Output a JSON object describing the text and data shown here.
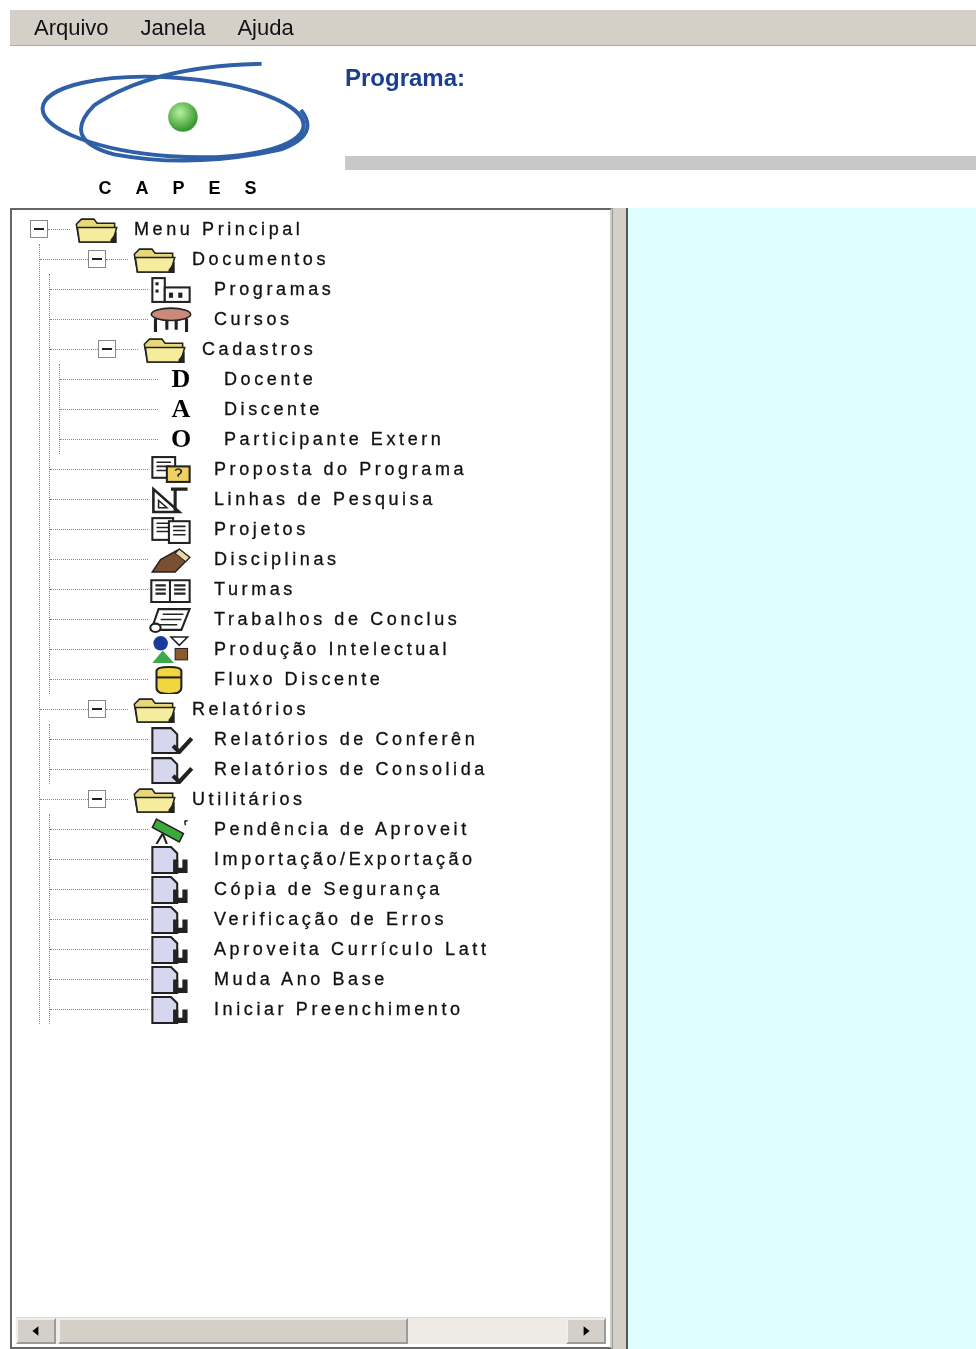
{
  "menu": [
    {
      "label": "Arquivo"
    },
    {
      "label": "Janela"
    },
    {
      "label": "Ajuda"
    }
  ],
  "header": {
    "logo_text": "CAPES",
    "program_label": "Programa:"
  },
  "tree": {
    "label": "Menu Principal",
    "kind": "folder",
    "expanded": true,
    "children": [
      {
        "label": "Documentos",
        "kind": "folder",
        "expanded": true,
        "children": [
          {
            "label": "Programas",
            "kind": "building"
          },
          {
            "label": "Cursos",
            "kind": "table"
          },
          {
            "label": "Cadastros",
            "kind": "folder",
            "expanded": true,
            "children": [
              {
                "label": "Docente",
                "kind": "letter",
                "glyph": "D"
              },
              {
                "label": "Discente",
                "kind": "letter",
                "glyph": "A"
              },
              {
                "label": "Participante Extern",
                "kind": "letter",
                "glyph": "O"
              }
            ]
          },
          {
            "label": "Proposta do Programa",
            "kind": "proposal"
          },
          {
            "label": "Linhas de Pesquisa",
            "kind": "ruler"
          },
          {
            "label": "Projetos",
            "kind": "pages"
          },
          {
            "label": "Disciplinas",
            "kind": "crayon"
          },
          {
            "label": "Turmas",
            "kind": "book"
          },
          {
            "label": "Trabalhos de Conclus",
            "kind": "scroll"
          },
          {
            "label": "Produção Intelectual",
            "kind": "shapes"
          },
          {
            "label": "Fluxo Discente",
            "kind": "head"
          }
        ]
      },
      {
        "label": "Relatórios",
        "kind": "folder",
        "expanded": true,
        "children": [
          {
            "label": "Relatórios de Conferên",
            "kind": "report"
          },
          {
            "label": "Relatórios de Consolida",
            "kind": "report"
          }
        ]
      },
      {
        "label": "Utilitários",
        "kind": "folder",
        "expanded": true,
        "children": [
          {
            "label": "Pendência de Aproveit",
            "kind": "telescope"
          },
          {
            "label": "Importação/Exportação",
            "kind": "tool"
          },
          {
            "label": "Cópia de Segurança",
            "kind": "tool"
          },
          {
            "label": "Verificação de Erros",
            "kind": "tool"
          },
          {
            "label": "Aproveita Currículo Latt",
            "kind": "tool"
          },
          {
            "label": "Muda Ano Base",
            "kind": "tool"
          },
          {
            "label": "Iniciar Preenchimento",
            "kind": "tool"
          }
        ]
      }
    ]
  }
}
